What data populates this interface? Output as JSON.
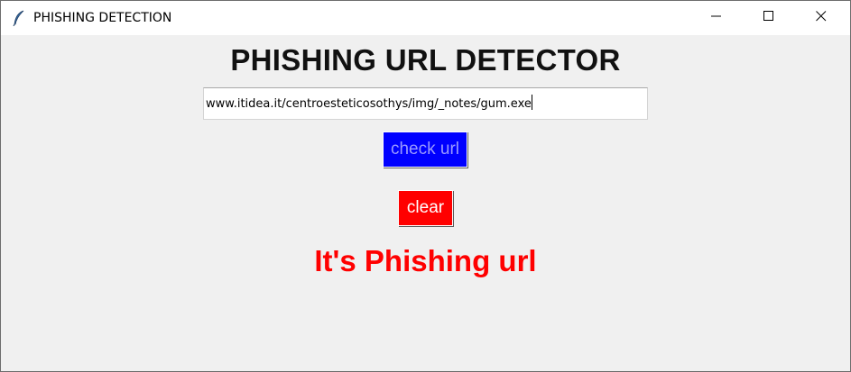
{
  "window": {
    "title": "PHISHING DETECTION",
    "app_icon": "feather-icon",
    "controls": [
      "minimize-icon",
      "maximize-icon",
      "close-icon"
    ]
  },
  "app": {
    "heading": "PHISHING URL DETECTOR",
    "url_input": {
      "value": "www.itidea.it/centroesteticosothys/img/_notes/gum.exe",
      "placeholder": ""
    },
    "check_button": {
      "label": "check url",
      "bg_color": "#0000ff"
    },
    "clear_button": {
      "label": "clear",
      "bg_color": "#ff0000"
    },
    "result": {
      "text": "It's Phishing url",
      "color": "#ff0000"
    }
  }
}
